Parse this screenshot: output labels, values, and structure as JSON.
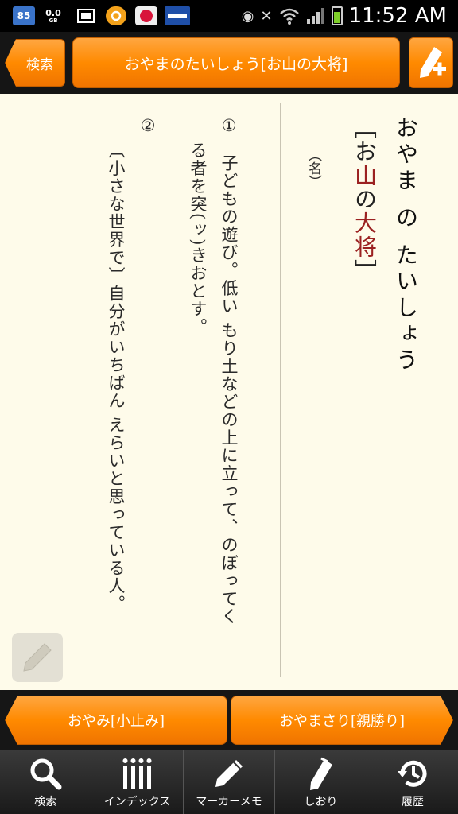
{
  "status_bar": {
    "notification_count": "85",
    "data_rate": "0.0",
    "data_unit": "GB",
    "time": "11:52 AM"
  },
  "header": {
    "back_label": "検索",
    "title": "おやまのたいしょう[お山の大将]"
  },
  "entry": {
    "headword": "おやま の たいしょう",
    "notation": {
      "open": "［",
      "part1": "お",
      "kanji1": "山",
      "part2": "の",
      "kanji2": "大将",
      "close": "］"
    },
    "part_of_speech": "（名）",
    "definitions": [
      {
        "number": "①",
        "line1": "子どもの遊び。低い もり土などの上に立って、のぼってく",
        "line2": "る者を突(ッ)きおとす。"
      },
      {
        "number": "②",
        "line1": "〔小さな世界で〕自分がいちばん えらいと思っている人。"
      }
    ]
  },
  "navigation": {
    "prev_label": "おやみ[小止み]",
    "next_label": "おやまさり[親勝り]"
  },
  "toolbar": {
    "items": [
      {
        "label": "検索",
        "icon": "search-icon"
      },
      {
        "label": "インデックス",
        "icon": "index-icon"
      },
      {
        "label": "マーカーメモ",
        "icon": "pencil-icon"
      },
      {
        "label": "しおり",
        "icon": "bookmark-icon"
      },
      {
        "label": "履歴",
        "icon": "history-icon"
      }
    ]
  },
  "colors": {
    "accent_orange": "#ff8a00",
    "paper": "#fefbea",
    "kanji_red": "#9b2121"
  }
}
